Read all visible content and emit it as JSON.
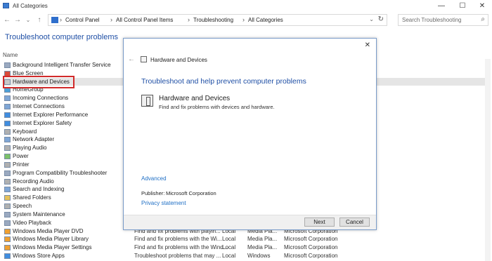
{
  "window": {
    "title": "All Categories",
    "controls": {
      "minimize": "—",
      "maximize": "☐",
      "close": "✕"
    }
  },
  "nav": {
    "back": "←",
    "forward": "→",
    "dropdown": "⌄",
    "up": "↑"
  },
  "address": {
    "sep": "›",
    "breadcrumbs": [
      "Control Panel",
      "All Control Panel Items",
      "Troubleshooting",
      "All Categories"
    ],
    "dropdown": "⌄",
    "refresh": "↻"
  },
  "search": {
    "placeholder": "Search Troubleshooting",
    "icon": "⌕"
  },
  "page": {
    "title": "Troubleshoot computer problems",
    "column_name": "Name"
  },
  "rows": [
    {
      "name": "Background Intelligent Transfer Service",
      "desc": "",
      "loc": "",
      "cat": "",
      "pub": "",
      "x": "",
      "icon": "#9aa9c0"
    },
    {
      "name": "Blue Screen",
      "desc": "",
      "loc": "",
      "cat": "",
      "pub": "",
      "x": "",
      "icon": "#d94a3a"
    },
    {
      "name": "Hardware and Devices",
      "desc": "",
      "loc": "",
      "cat": "",
      "pub": "",
      "x": "",
      "icon": "#c8c8c8"
    },
    {
      "name": "HomeGroup",
      "desc": "",
      "loc": "",
      "cat": "",
      "pub": "",
      "x": "",
      "icon": "#4aa0d8"
    },
    {
      "name": "Incoming Connections",
      "desc": "",
      "loc": "",
      "cat": "",
      "pub": "",
      "x": "",
      "icon": "#7fa6d6"
    },
    {
      "name": "Internet Connections",
      "desc": "",
      "loc": "",
      "cat": "",
      "pub": "",
      "x": "",
      "icon": "#7fa6d6"
    },
    {
      "name": "Internet Explorer Performance",
      "desc": "",
      "loc": "",
      "cat": "",
      "pub": "",
      "x": "",
      "icon": "#3f8de0"
    },
    {
      "name": "Internet Explorer Safety",
      "desc": "",
      "loc": "",
      "cat": "",
      "pub": "",
      "x": "",
      "icon": "#3f8de0"
    },
    {
      "name": "Keyboard",
      "desc": "",
      "loc": "",
      "cat": "",
      "pub": "",
      "x": "",
      "icon": "#b0b0b0"
    },
    {
      "name": "Network Adapter",
      "desc": "",
      "loc": "",
      "cat": "",
      "pub": "",
      "x": "",
      "icon": "#7fa6d6"
    },
    {
      "name": "Playing Audio",
      "desc": "",
      "loc": "",
      "cat": "",
      "pub": "",
      "x": "",
      "icon": "#b0b0b0"
    },
    {
      "name": "Power",
      "desc": "",
      "loc": "",
      "cat": "",
      "pub": "",
      "x": "",
      "icon": "#7cc16a"
    },
    {
      "name": "Printer",
      "desc": "",
      "loc": "",
      "cat": "",
      "pub": "",
      "x": "",
      "icon": "#b0b0b0"
    },
    {
      "name": "Program Compatibility Troubleshooter",
      "desc": "",
      "loc": "",
      "cat": "",
      "pub": "",
      "x": "",
      "icon": "#9aa9c0"
    },
    {
      "name": "Recording Audio",
      "desc": "",
      "loc": "",
      "cat": "",
      "pub": "",
      "x": "",
      "icon": "#b0b0b0"
    },
    {
      "name": "Search and Indexing",
      "desc": "",
      "loc": "",
      "cat": "",
      "pub": "",
      "x": "",
      "icon": "#7fa6d6"
    },
    {
      "name": "Shared Folders",
      "desc": "",
      "loc": "",
      "cat": "",
      "pub": "",
      "x": "",
      "icon": "#e6c15a"
    },
    {
      "name": "Speech",
      "desc": "",
      "loc": "",
      "cat": "",
      "pub": "",
      "x": "",
      "icon": "#b0b0b0"
    },
    {
      "name": "System Maintenance",
      "desc": "",
      "loc": "",
      "cat": "",
      "pub": "",
      "x": "",
      "icon": "#9aa9c0"
    },
    {
      "name": "Video Playback",
      "desc": "",
      "loc": "",
      "cat": "",
      "pub": "",
      "x": "",
      "icon": "#9aa9c0"
    },
    {
      "name": "Windows Media Player DVD",
      "desc": "Find and fix problems with playin...",
      "loc": "Local",
      "cat": "Media Pla...",
      "pub": "Microsoft Corporation",
      "x": "",
      "icon": "#f0a030"
    },
    {
      "name": "Windows Media Player Library",
      "desc": "Find and fix problems with the Wi...",
      "loc": "Local",
      "cat": "Media Pla...",
      "pub": "Microsoft Corporation",
      "x": "",
      "icon": "#f0a030"
    },
    {
      "name": "Windows Media Player Settings",
      "desc": "Find and fix problems with the Wind...",
      "loc": "Local",
      "cat": "Media Pla...",
      "pub": "Microsoft Corporation",
      "x": "",
      "icon": "#f0a030"
    },
    {
      "name": "Windows Store Apps",
      "desc": "Troubleshoot problems that may ...",
      "loc": "Local",
      "cat": "Windows",
      "pub": "Microsoft Corporation",
      "x": "",
      "icon": "#3f8de0"
    }
  ],
  "dialog": {
    "close": "✕",
    "back": "←",
    "title": "Hardware and Devices",
    "heading": "Troubleshoot and help prevent computer problems",
    "item_title": "Hardware and Devices",
    "item_desc": "Find and fix problems with devices and hardware.",
    "advanced": "Advanced",
    "publisher_label": "Publisher:",
    "publisher_value": "Microsoft Corporation",
    "privacy": "Privacy statement",
    "next": "Next",
    "cancel": "Cancel"
  }
}
